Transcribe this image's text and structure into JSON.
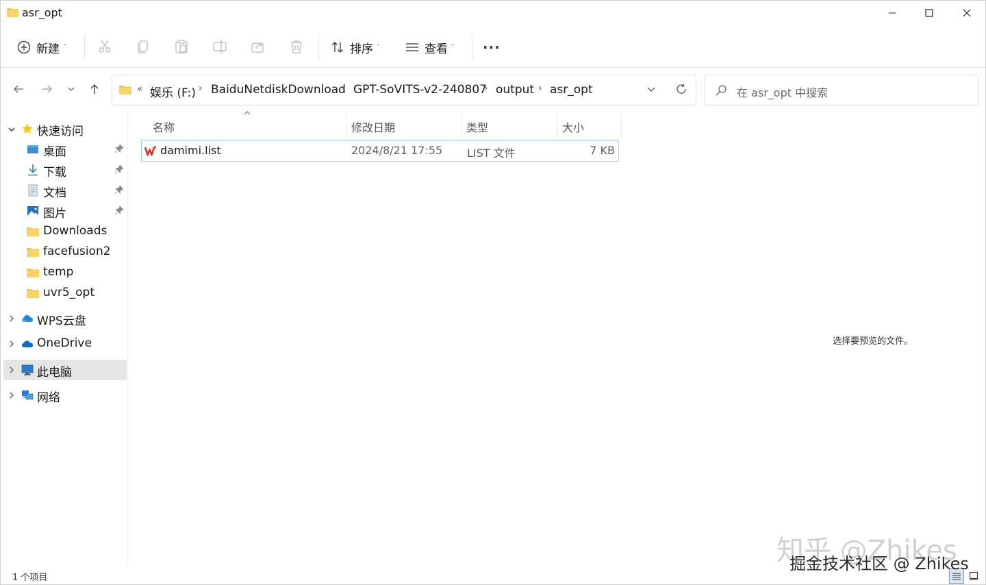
{
  "window": {
    "title": "asr_opt"
  },
  "toolbar": {
    "new_label": "新建",
    "sort_label": "排序",
    "view_label": "查看",
    "more_label": "···",
    "caret": "ˇ"
  },
  "address": {
    "overflow": "«",
    "segments": [
      "娱乐 (F:)",
      "BaiduNetdiskDownload",
      "GPT-SoVITS-v2-240807",
      "output",
      "asr_opt"
    ],
    "separator": "›"
  },
  "search": {
    "placeholder": "在 asr_opt 中搜索"
  },
  "sidebar": {
    "quick_access": "快速访问",
    "items": [
      {
        "label": "桌面",
        "icon": "desktop-icon",
        "pinned": true
      },
      {
        "label": "下载",
        "icon": "download-icon",
        "pinned": true
      },
      {
        "label": "文档",
        "icon": "document-icon",
        "pinned": true
      },
      {
        "label": "图片",
        "icon": "pictures-icon",
        "pinned": true
      },
      {
        "label": "Downloads",
        "icon": "folder-icon",
        "pinned": false
      },
      {
        "label": "facefusion2",
        "icon": "folder-icon",
        "pinned": false
      },
      {
        "label": "temp",
        "icon": "folder-icon",
        "pinned": false
      },
      {
        "label": "uvr5_opt",
        "icon": "folder-icon",
        "pinned": false
      }
    ],
    "wps_cloud": "WPS云盘",
    "onedrive": "OneDrive",
    "this_pc": "此电脑",
    "network": "网络"
  },
  "columns": {
    "name": "名称",
    "modified": "修改日期",
    "type": "类型",
    "size": "大小"
  },
  "files": [
    {
      "name": "damimi.list",
      "modified": "2024/8/21 17:55",
      "type": "LIST 文件",
      "size": "7 KB"
    }
  ],
  "preview": {
    "message": "选择要预览的文件。"
  },
  "status": {
    "count": "1 个项目"
  },
  "watermark": {
    "line1": "知乎 @Zhikes",
    "line2": "掘金技术社区 @ Zhikes"
  },
  "colors": {
    "folder": "#f3c44f",
    "accent": "#0067c0",
    "selection_border": "#99d1ff",
    "wps_red": "#d93025"
  }
}
